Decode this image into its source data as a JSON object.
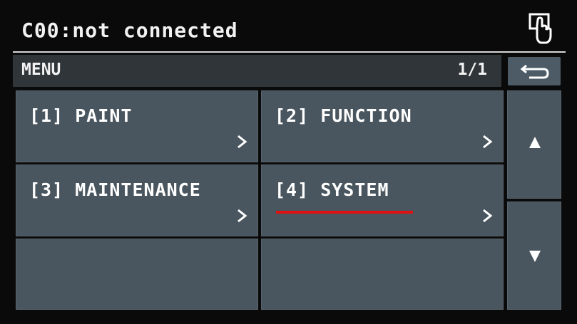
{
  "status": {
    "text": "C00:not connected",
    "touch_icon": "touch-hand-icon"
  },
  "header": {
    "title": "MENU",
    "page": "1/1",
    "back_icon": "back-arrow-icon"
  },
  "menu": {
    "items": [
      {
        "label": "[1] PAINT"
      },
      {
        "label": "[2] FUNCTION"
      },
      {
        "label": "[3] MAINTENANCE"
      },
      {
        "label": "[4] SYSTEM"
      }
    ]
  },
  "scroll": {
    "up_icon": "triangle-up-icon",
    "down_icon": "triangle-down-icon"
  },
  "colors": {
    "tile": "#4a565f",
    "header": "#2f3539",
    "highlight": "#e01010"
  }
}
